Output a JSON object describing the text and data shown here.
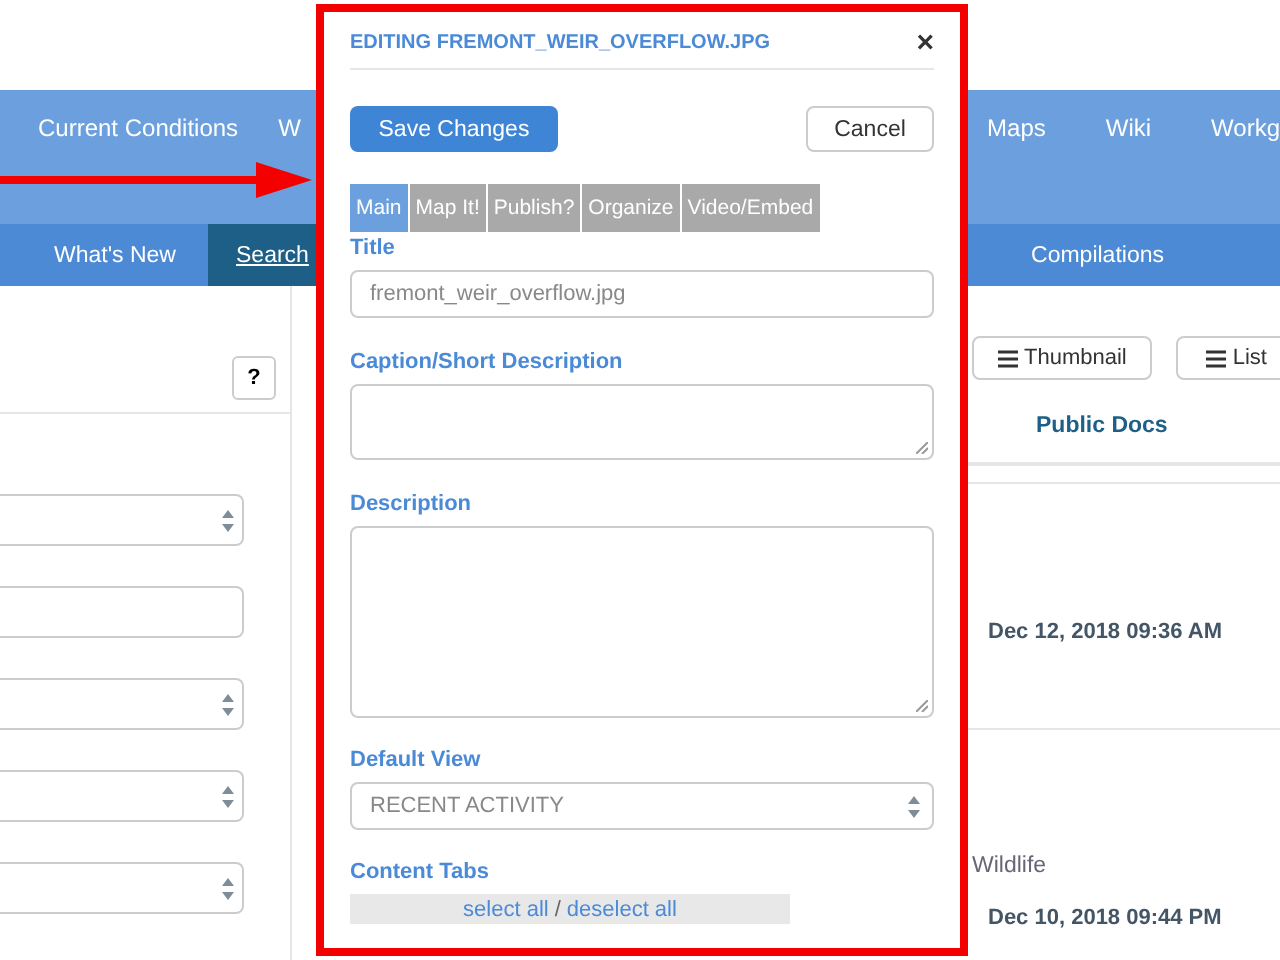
{
  "nav": {
    "left_items": [
      {
        "label": "Current Conditions"
      },
      {
        "label": "W"
      }
    ],
    "right_items": [
      {
        "label": "Maps"
      },
      {
        "label": "Wiki"
      },
      {
        "label": "Workg"
      }
    ]
  },
  "subnav": {
    "left_items": [
      {
        "label": "What's New",
        "selected": false
      },
      {
        "label": "Search",
        "selected": true
      }
    ],
    "right_items": [
      {
        "label": "Compilations",
        "selected": false
      }
    ]
  },
  "sidebar": {
    "help_button": "?",
    "fields": [
      {
        "kind": "select"
      },
      {
        "kind": "input"
      },
      {
        "kind": "select"
      },
      {
        "kind": "select"
      },
      {
        "kind": "select"
      }
    ]
  },
  "results": {
    "view_buttons": [
      {
        "label": "Thumbnail"
      },
      {
        "label": "List"
      }
    ],
    "column_header": "Public Docs",
    "rows": [
      {
        "date": "Dec 12, 2018 09:36 AM"
      },
      {
        "tag": "Wildlife",
        "date": "Dec 10, 2018 09:44 PM"
      }
    ]
  },
  "dialog": {
    "title": "EDITING FREMONT_WEIR_OVERFLOW.JPG",
    "close": "×",
    "save_button": "Save Changes",
    "cancel_button": "Cancel",
    "tabs": [
      {
        "label": "Main",
        "selected": true
      },
      {
        "label": "Map It!",
        "selected": false
      },
      {
        "label": "Publish?",
        "selected": false
      },
      {
        "label": "Organize",
        "selected": false
      },
      {
        "label": "Video/Embed",
        "selected": false
      }
    ],
    "fields": [
      {
        "label": "Title",
        "kind": "input",
        "value": "fremont_weir_overflow.jpg"
      },
      {
        "label": "Caption/Short Description",
        "kind": "textarea"
      },
      {
        "label": "Description",
        "kind": "textarea"
      },
      {
        "label": "Default View",
        "kind": "select",
        "value": "RECENT ACTIVITY"
      }
    ],
    "content_tabs": {
      "label": "Content Tabs",
      "select_all": "select all",
      "separator": "/",
      "deselect_all": "deselect all"
    }
  }
}
